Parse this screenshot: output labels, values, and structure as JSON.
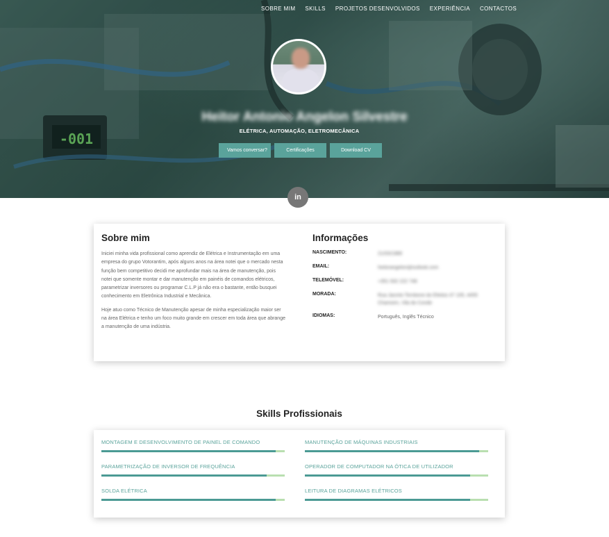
{
  "nav": {
    "items": [
      "SOBRE MIM",
      "SKILLS",
      "PROJETOS DESENVOLVIDOS",
      "EXPERIÊNCIA",
      "CONTACTOS"
    ]
  },
  "hero": {
    "name": "Heitor Antonio Angelon Silvestre",
    "subtitle": "ELÉTRICA, AUTOMAÇÃO, ELETROMECÂNICA",
    "buttons": [
      "Vamos conversar?",
      "Certificações",
      "Download CV"
    ],
    "social_icon": "linkedin-icon",
    "social_label": "in",
    "display_value": "-001"
  },
  "about": {
    "title": "Sobre mim",
    "paragraphs": [
      "Iniciei minha vida profissional como aprendiz de Elétrica e Instrumentação em uma empresa do grupo Votorantim, após alguns anos na área notei que o mercado nesta função bem competitivo decidi me aprofundar mais na área de manutenção, pois notei que somente montar e dar manutenção em painéis de comandos elétricos, parametrizar inversores ou programar C.L.P já não era o bastante, então busquei conhecimento em Eletrônica Industrial e Mecânica.",
      "Hoje atuo como Técnico de Manutenção apesar de minha especialização maior ser na área Elétrica e tenho um foco muito grande em crescer em toda área que abrange a manutenção de uma indústria."
    ]
  },
  "info": {
    "title": "Informações",
    "rows": [
      {
        "label": "NASCIMENTO:",
        "value": "21/03/1989"
      },
      {
        "label": "EMAIL:",
        "value": "heitorangelon@outlook.com"
      },
      {
        "label": "TELEMÓVEL:",
        "value": "+351 932 222 748"
      },
      {
        "label": "MORADA:",
        "value": "Rua Jacinto Tornbone do Efeitos 47 105, 4455 Chamoirn, Vila do Conde"
      },
      {
        "label": "IDIOMAS:",
        "value": "Português, Inglês Técnico"
      }
    ]
  },
  "skills": {
    "title": "Skills Profissionais",
    "items": [
      {
        "label": "MONTAGEM E DESENVOLVIMENTO DE PAINEL DE COMANDO",
        "level": 0.95
      },
      {
        "label": "MANUTENÇÃO DE MÁQUINAS INDUSTRIAIS",
        "level": 0.95
      },
      {
        "label": "PARAMETRIZAÇÃO DE INVERSOR DE FREQUÊNCIA",
        "level": 0.9
      },
      {
        "label": "OPERADOR DE COMPUTADOR NA ÓTICA DE UTILIZADOR",
        "level": 0.9
      },
      {
        "label": "SOLDA ELÉTRICA",
        "level": 0.95
      },
      {
        "label": "LEITURA DE DIAGRAMAS ELÉTRICOS",
        "level": 0.9
      }
    ]
  },
  "colors": {
    "accent": "#5aa39b",
    "bar_track": "#b9dfb0",
    "bar_fill": "#4b9a94"
  }
}
